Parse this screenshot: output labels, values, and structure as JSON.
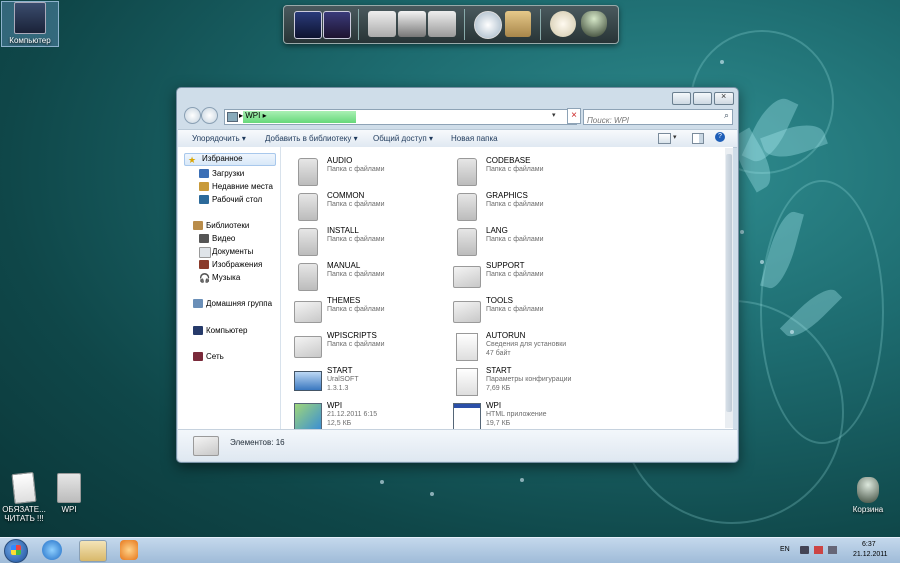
{
  "desktop": {
    "icons": [
      {
        "label": "Компьютер"
      },
      {
        "label": "ОБЯЗАТЕ... ЧИТАТЬ !!!"
      },
      {
        "label": "WPI"
      },
      {
        "label": "Корзина"
      }
    ]
  },
  "explorer": {
    "address": {
      "path": "WPI"
    },
    "search": {
      "placeholder": "Поиск: WPI"
    },
    "toolbar": {
      "organize": "Упорядочить",
      "add_to_library": "Добавить в библиотеку",
      "share": "Общий доступ",
      "new_folder": "Новая папка"
    },
    "sidebar": {
      "favorites": "Избранное",
      "downloads": "Загрузки",
      "recent": "Недавние места",
      "desktop": "Рабочий стол",
      "libraries": "Библиотеки",
      "video": "Видео",
      "documents": "Документы",
      "images": "Изображения",
      "music": "Музыка",
      "homegroup": "Домашняя группа",
      "computer": "Компьютер",
      "network": "Сеть"
    },
    "files": [
      {
        "name": "AUDIO",
        "type": "Папка с файлами"
      },
      {
        "name": "CODEBASE",
        "type": "Папка с файлами"
      },
      {
        "name": "COMMON",
        "type": "Папка с файлами"
      },
      {
        "name": "GRAPHICS",
        "type": "Папка с файлами"
      },
      {
        "name": "INSTALL",
        "type": "Папка с файлами"
      },
      {
        "name": "LANG",
        "type": "Папка с файлами"
      },
      {
        "name": "MANUAL",
        "type": "Папка с файлами"
      },
      {
        "name": "SUPPORT",
        "type": "Папка с файлами"
      },
      {
        "name": "THEMES",
        "type": "Папка с файлами"
      },
      {
        "name": "TOOLS",
        "type": "Папка с файлами"
      },
      {
        "name": "WPISCRIPTS",
        "type": "Папка с файлами"
      },
      {
        "name": "AUTORUN",
        "type": "Сведения для установки",
        "size": "47 байт"
      },
      {
        "name": "START",
        "type": "UralSOFT",
        "size": "1.3.1.3"
      },
      {
        "name": "START",
        "type": "Параметры конфигурации",
        "size": "7,69 КБ"
      },
      {
        "name": "WPI",
        "type": "21.12.2011 6:15",
        "size": "12,5 КБ"
      },
      {
        "name": "WPI",
        "type": "HTML приложение",
        "size": "19,7 КБ"
      }
    ],
    "details": {
      "count": "Элементов: 16"
    }
  },
  "taskbar": {
    "language": "EN",
    "time": "6:37",
    "date": "21.12.2011"
  }
}
